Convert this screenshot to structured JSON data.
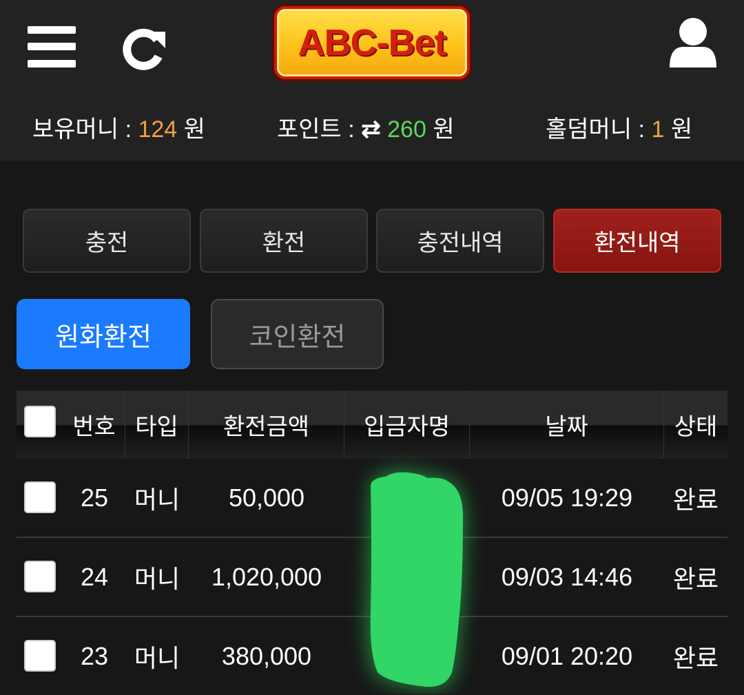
{
  "header": {
    "logo_text": "ABC-Bet",
    "icons": {
      "menu": "menu-icon",
      "refresh": "refresh-icon",
      "user": "user-icon"
    }
  },
  "balances": {
    "money": {
      "label": "보유머니 : ",
      "value": "124",
      "unit": " 원"
    },
    "point": {
      "label": "포인트 : ",
      "swap_icon": "⇄",
      "value": "260",
      "unit": " 원"
    },
    "holdem": {
      "label": "홀덤머니 : ",
      "value": "1",
      "unit": " 원"
    }
  },
  "tabs": [
    {
      "label": "충전",
      "active": false
    },
    {
      "label": "환전",
      "active": false
    },
    {
      "label": "충전내역",
      "active": false
    },
    {
      "label": "환전내역",
      "active": true
    }
  ],
  "subtabs": [
    {
      "label": "원화환전",
      "active": true
    },
    {
      "label": "코인환전",
      "active": false
    }
  ],
  "table": {
    "columns": [
      "번호",
      "타입",
      "환전금액",
      "입금자명",
      "날짜",
      "상태"
    ],
    "rows": [
      {
        "no": "25",
        "type": "머니",
        "amount": "50,000",
        "depositor": "",
        "date": "09/05 19:29",
        "status": "완료"
      },
      {
        "no": "24",
        "type": "머니",
        "amount": "1,020,000",
        "depositor": "",
        "date": "09/03 14:46",
        "status": "완료"
      },
      {
        "no": "23",
        "type": "머니",
        "amount": "380,000",
        "depositor": "",
        "date": "09/01 20:20",
        "status": "완료"
      }
    ]
  },
  "colors": {
    "accent_red": "#a0201c",
    "accent_blue": "#1a7bff",
    "money_orange": "#f0a23a",
    "point_green": "#5bd95b",
    "redaction_green": "#2fd35f"
  }
}
